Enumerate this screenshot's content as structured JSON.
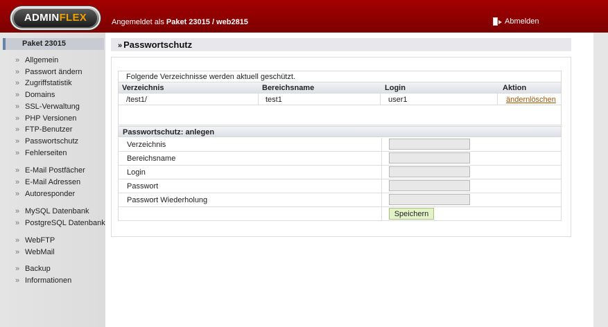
{
  "header": {
    "logo_part1": "ADMIN",
    "logo_part2": "FLEX",
    "login_prefix": "Angemeldet als ",
    "login_user": "Paket 23015 / web2815",
    "logout_label": "Abmelden"
  },
  "sidebar": {
    "title": "Paket 23015",
    "items": [
      {
        "label": "Allgemein"
      },
      {
        "label": "Passwort ändern"
      },
      {
        "label": "Zugriffstatistik"
      },
      {
        "label": "Domains"
      },
      {
        "label": "SSL-Verwaltung"
      },
      {
        "label": "PHP Versionen"
      },
      {
        "label": "FTP-Benutzer"
      },
      {
        "label": "Passwortschutz"
      },
      {
        "label": "Fehlerseiten"
      },
      {
        "label": "E-Mail Postfächer"
      },
      {
        "label": "E-Mail Adressen"
      },
      {
        "label": "Autoresponder"
      },
      {
        "label": "MySQL Datenbank"
      },
      {
        "label": "PostgreSQL Datenbank"
      },
      {
        "label": "WebFTP"
      },
      {
        "label": "WebMail"
      },
      {
        "label": "Backup"
      },
      {
        "label": "Informationen"
      }
    ],
    "bullet": "»"
  },
  "page": {
    "title_prefix": "»",
    "title": "Passwortschutz"
  },
  "protected_list": {
    "caption": "Folgende Verzeichnisse werden aktuell geschützt.",
    "columns": [
      "Verzeichnis",
      "Bereichsname",
      "Login",
      "Aktion"
    ],
    "rows": [
      {
        "verzeichnis": "/test1/",
        "bereichsname": "test1",
        "login": "user1",
        "edit": "ändern",
        "delete": "löschen"
      }
    ]
  },
  "form": {
    "header": "Passwortschutz: anlegen",
    "fields": [
      {
        "label": "Verzeichnis",
        "value": ""
      },
      {
        "label": "Bereichsname",
        "value": ""
      },
      {
        "label": "Login",
        "value": ""
      },
      {
        "label": "Passwort",
        "value": ""
      },
      {
        "label": "Passwort Wiederholung",
        "value": ""
      }
    ],
    "submit_label": "Speichern"
  }
}
